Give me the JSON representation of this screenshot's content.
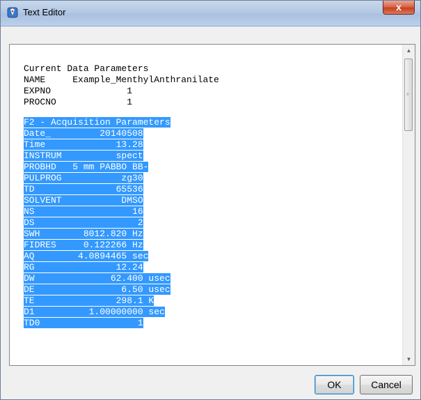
{
  "window": {
    "title": "Text Editor",
    "close_glyph": "x"
  },
  "editor": {
    "header_lines": [
      "Current Data Parameters",
      "NAME     Example_MenthylAnthranilate",
      "EXPNO              1",
      "PROCNO             1"
    ],
    "selected_lines": [
      "F2 - Acquisition Parameters",
      "Date_         20140508",
      "Time             13.28",
      "INSTRUM          spect",
      "PROBHD   5 mm PABBO BB-",
      "PULPROG           zg30",
      "TD               65536",
      "SOLVENT           DMSO",
      "NS                  16",
      "DS                   2",
      "SWH        8012.820 Hz",
      "FIDRES     0.122266 Hz",
      "AQ        4.0894465 sec",
      "RG               12.24",
      "DW              62.400 usec",
      "DE                6.50 usec",
      "TE               298.1 K",
      "D1          1.00000000 sec",
      "TD0                  1"
    ]
  },
  "buttons": {
    "ok": "OK",
    "cancel": "Cancel"
  },
  "icons": {
    "app": "text-editor-icon",
    "scroll_up": "scroll-up-arrow-icon",
    "scroll_down": "scroll-down-arrow-icon"
  },
  "colors": {
    "selection": "#3399ff",
    "titlebar": "#b4c9e4",
    "close": "#c8401f"
  }
}
